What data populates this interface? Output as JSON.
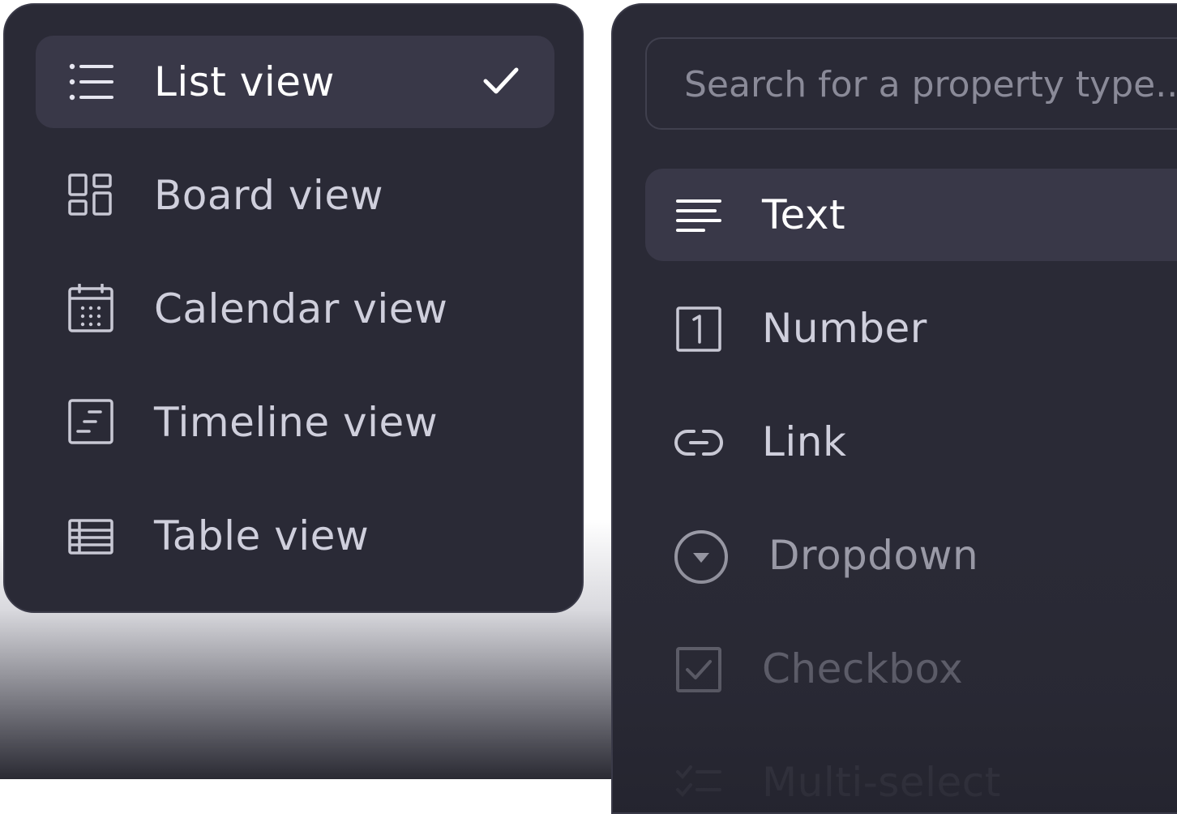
{
  "view_menu": {
    "items": [
      {
        "label": "List view",
        "icon": "list-icon",
        "selected": true
      },
      {
        "label": "Board view",
        "icon": "board-icon",
        "selected": false
      },
      {
        "label": "Calendar view",
        "icon": "calendar-icon",
        "selected": false
      },
      {
        "label": "Timeline view",
        "icon": "timeline-icon",
        "selected": false
      },
      {
        "label": "Table view",
        "icon": "table-icon",
        "selected": false
      }
    ]
  },
  "property_menu": {
    "search": {
      "placeholder": "Search for a property type..."
    },
    "items": [
      {
        "label": "Text",
        "icon": "text-icon",
        "selected": true
      },
      {
        "label": "Number",
        "icon": "number-icon",
        "selected": false
      },
      {
        "label": "Link",
        "icon": "link-icon",
        "selected": false
      },
      {
        "label": "Dropdown",
        "icon": "dropdown-icon",
        "selected": false
      },
      {
        "label": "Checkbox",
        "icon": "checkbox-icon",
        "selected": false
      },
      {
        "label": "Multi-select",
        "icon": "multi-select-icon",
        "selected": false
      }
    ]
  },
  "colors": {
    "menu_background": "#2a2a36",
    "selected_background": "#393848",
    "text": "#cfcfdc",
    "text_selected": "#ffffff"
  }
}
